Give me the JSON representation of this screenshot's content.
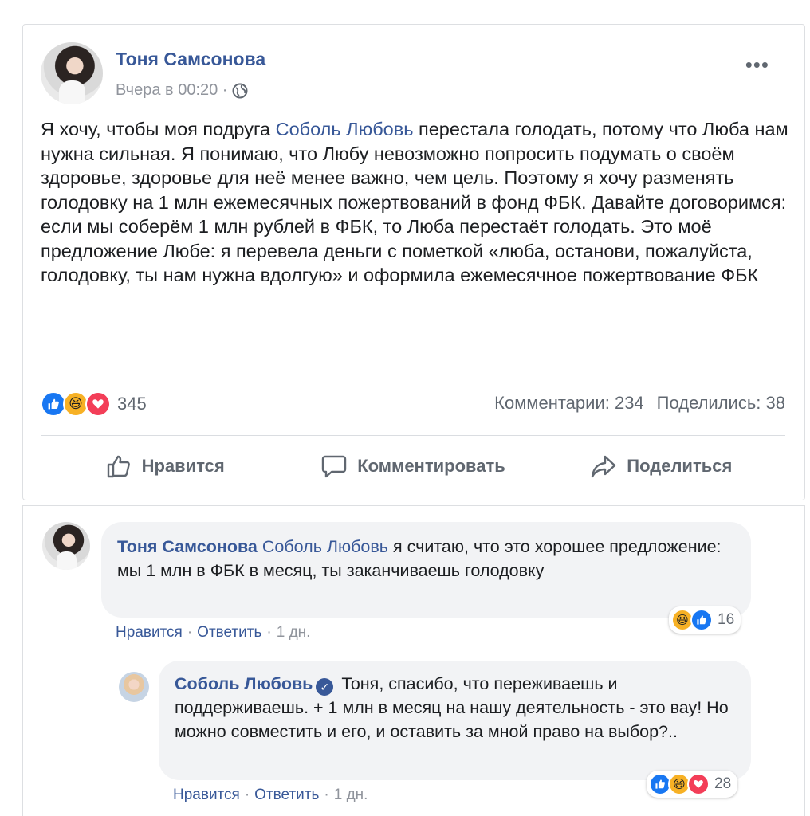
{
  "post": {
    "author": "Тоня Самсонова",
    "time": "Вчера в 00:20 ·",
    "more_icon": "more-icon",
    "text_part1": "Я хочу, чтобы моя подруга ",
    "mention": "Соболь Любовь",
    "text_part2": " перестала голодать, потому что Люба нам нужна сильная. Я понимаю, что Любу невозможно попросить подумать о своём здоровье, здоровье для неё менее важно, чем цель. Поэтому я хочу разменять голодовку на 1 млн ежемесячных пожертвований в фонд ФБК. Давайте договоримся: если мы соберём 1 млн рублей в ФБК, то Люба перестаёт голодать. Это моё предложение Любе: я перевела деньги с пометкой «люба, останови, пожалуйста, голодовку, ты нам нужна вдолгую» и оформила ежемесячное пожертвование ФБК",
    "reaction_count": "345",
    "comments": "Комментарии: 234",
    "shares": "Поделились: 38",
    "actions": {
      "like": "Нравится",
      "comment": "Комментировать",
      "share": "Поделиться"
    }
  },
  "comments": [
    {
      "author": "Тоня Самсонова",
      "mention": "Соболь Любовь",
      "text": " я считаю, что это хорошее предложение: мы 1 млн в ФБК в месяц, ты заканчиваешь голодовку",
      "reaction_count": "16",
      "like": "Нравится",
      "reply": "Ответить",
      "time": "1 дн."
    },
    {
      "author": "Соболь Любовь",
      "text": "Тоня, спасибо, что переживаешь и поддерживаешь. + 1 млн в месяц на нашу деятельность - это вау! Но можно совместить и его, и оставить за мной право на выбор?..",
      "reaction_count": "28",
      "like": "Нравится",
      "reply": "Ответить",
      "time": "1 дн."
    }
  ],
  "colors": {
    "link": "#385898",
    "muted": "#606770",
    "like": "#1877f2",
    "haha": "#f7b125",
    "love": "#f33e58"
  }
}
